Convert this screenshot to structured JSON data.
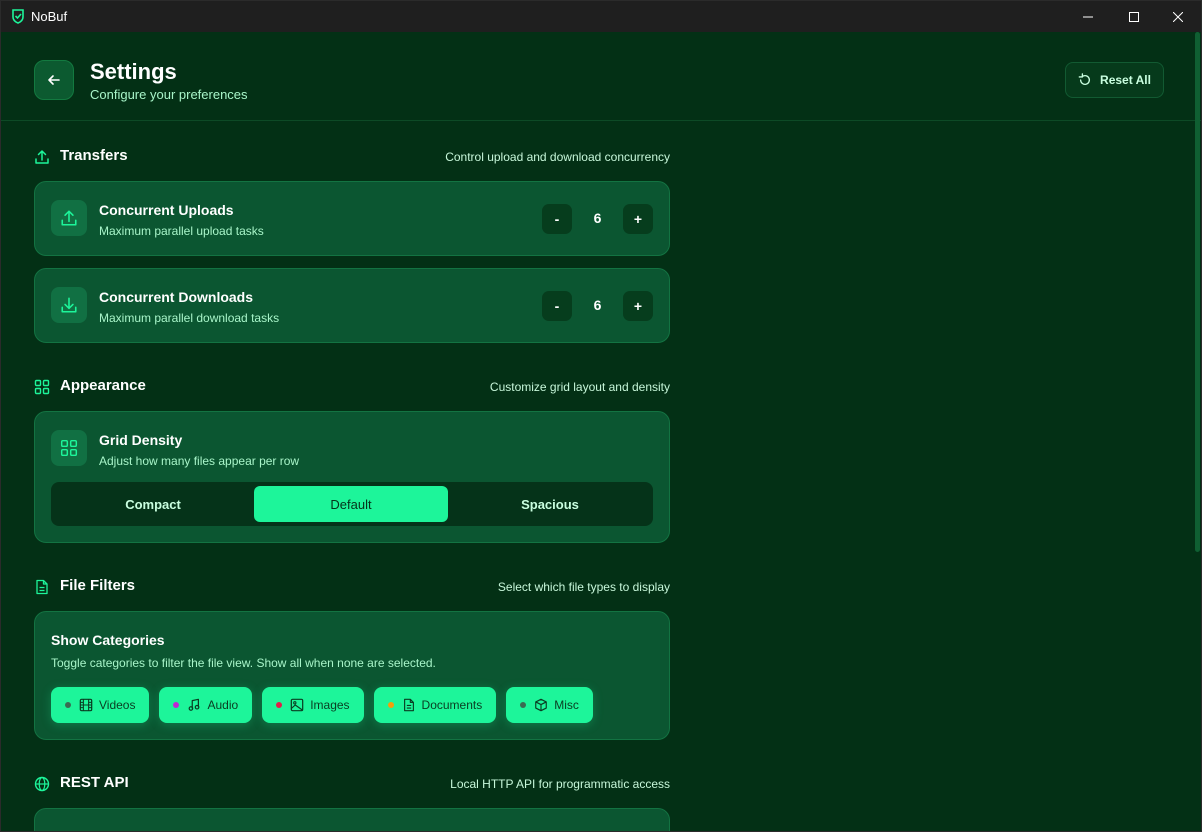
{
  "app": {
    "title": "NoBuf"
  },
  "header": {
    "title": "Settings",
    "subtitle": "Configure your preferences",
    "reset_label": "Reset All"
  },
  "transfers": {
    "title": "Transfers",
    "description": "Control upload and download concurrency",
    "uploads": {
      "title": "Concurrent Uploads",
      "subtitle": "Maximum parallel upload tasks",
      "value": "6",
      "minus": "-",
      "plus": "+"
    },
    "downloads": {
      "title": "Concurrent Downloads",
      "subtitle": "Maximum parallel download tasks",
      "value": "6",
      "minus": "-",
      "plus": "+"
    }
  },
  "appearance": {
    "title": "Appearance",
    "description": "Customize grid layout and density",
    "grid": {
      "title": "Grid Density",
      "subtitle": "Adjust how many files appear per row",
      "options": [
        "Compact",
        "Default",
        "Spacious"
      ],
      "selected": "Default"
    }
  },
  "filters": {
    "title": "File Filters",
    "description": "Select which file types to display",
    "card_title": "Show Categories",
    "card_subtitle": "Toggle categories to filter the file view. Show all when none are selected.",
    "chips": [
      {
        "label": "Videos",
        "dot": "#3a6b52",
        "icon": "film-icon"
      },
      {
        "label": "Audio",
        "dot": "#c026d3",
        "icon": "music-icon"
      },
      {
        "label": "Images",
        "dot": "#e11d48",
        "icon": "image-icon"
      },
      {
        "label": "Documents",
        "dot": "#f59e0b",
        "icon": "document-icon"
      },
      {
        "label": "Misc",
        "dot": "#3a6b52",
        "icon": "box-icon"
      }
    ]
  },
  "rest_api": {
    "title": "REST API",
    "description": "Local HTTP API for programmatic access"
  },
  "colors": {
    "accent": "#1df59a",
    "background": "#033015",
    "card": "#0b5631"
  }
}
